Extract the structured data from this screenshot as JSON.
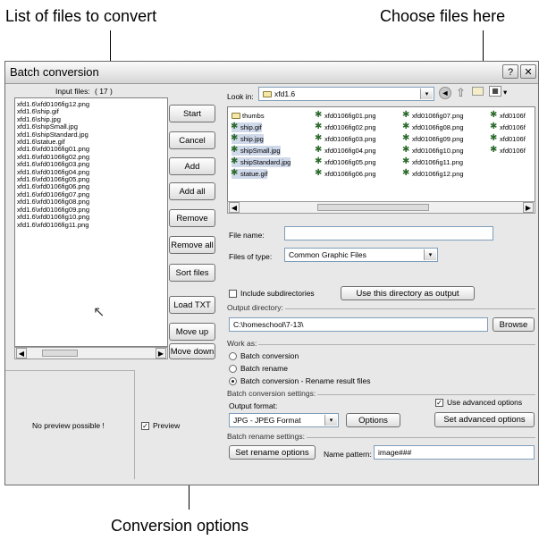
{
  "callouts": {
    "list_of_files": "List of files to convert",
    "choose_files": "Choose files here",
    "conversion_options": "Conversion options"
  },
  "window": {
    "title": "Batch conversion",
    "help_label": "?",
    "close_label": "✕"
  },
  "input_files": {
    "label": "Input files:",
    "count": "( 17 )",
    "files": [
      "xfd1.6\\xfd0106fig12.png",
      "xfd1.6\\ship.gif",
      "xfd1.6\\ship.jpg",
      "xfd1.6\\shipSmall.jpg",
      "xfd1.6\\shipStandard.jpg",
      "xfd1.6\\statue.gif",
      "xfd1.6\\xfd0106fig01.png",
      "xfd1.6\\xfd0106fig02.png",
      "xfd1.6\\xfd0106fig03.png",
      "xfd1.6\\xfd0106fig04.png",
      "xfd1.6\\xfd0106fig05.png",
      "xfd1.6\\xfd0106fig06.png",
      "xfd1.6\\xfd0106fig07.png",
      "xfd1.6\\xfd0106fig08.png",
      "xfd1.6\\xfd0106fig09.png",
      "xfd1.6\\xfd0106fig10.png",
      "xfd1.6\\xfd0106fig11.png"
    ]
  },
  "buttons": {
    "start": "Start",
    "cancel": "Cancel",
    "add": "Add",
    "add_all": "Add all",
    "remove": "Remove",
    "remove_all": "Remove all",
    "sort_files": "Sort files",
    "load_txt": "Load TXT",
    "move_up": "Move up",
    "move_down": "Move down"
  },
  "preview": {
    "no_preview": "No preview possible !",
    "checkbox_label": "Preview",
    "checked": true
  },
  "browser": {
    "look_in_label": "Look in:",
    "look_in_value": "xfd1.6",
    "col1": [
      "thumbs",
      "ship.gif",
      "ship.jpg",
      "shipSmall.jpg",
      "shipStandard.jpg",
      "statue.gif"
    ],
    "col2": [
      "xfd0106fig01.png",
      "xfd0106fig02.png",
      "xfd0106fig03.png",
      "xfd0106fig04.png",
      "xfd0106fig05.png",
      "xfd0106fig06.png"
    ],
    "col3": [
      "xfd0106fig07.png",
      "xfd0106fig08.png",
      "xfd0106fig09.png",
      "xfd0106fig10.png",
      "xfd0106fig11.png",
      "xfd0106fig12.png"
    ],
    "col4": [
      "xfd0106f",
      "xfd0106f",
      "xfd0106f",
      "xfd0106f"
    ],
    "file_name_label": "File name:",
    "file_name_value": "",
    "files_of_type_label": "Files of type:",
    "files_of_type_value": "Common Graphic Files"
  },
  "directory": {
    "include_subdirs": "Include subdirectories",
    "use_as_output": "Use this directory as output",
    "output_dir_label": "Output directory:",
    "output_dir_value": "C:\\homeschool\\7-13\\",
    "browse": "Browse"
  },
  "work_as": {
    "label": "Work as:",
    "options": [
      "Batch conversion",
      "Batch rename",
      "Batch conversion - Rename result files"
    ],
    "selected_index": 2
  },
  "conversion_settings": {
    "label": "Batch conversion settings:",
    "output_format_label": "Output format:",
    "output_format_value": "JPG - JPEG Format",
    "options_button": "Options",
    "use_advanced": "Use advanced options",
    "use_advanced_checked": true,
    "set_advanced": "Set advanced options"
  },
  "rename_settings": {
    "label": "Batch rename settings:",
    "set_rename": "Set rename options",
    "name_pattern_label": "Name pattern:",
    "name_pattern_value": "image###"
  }
}
